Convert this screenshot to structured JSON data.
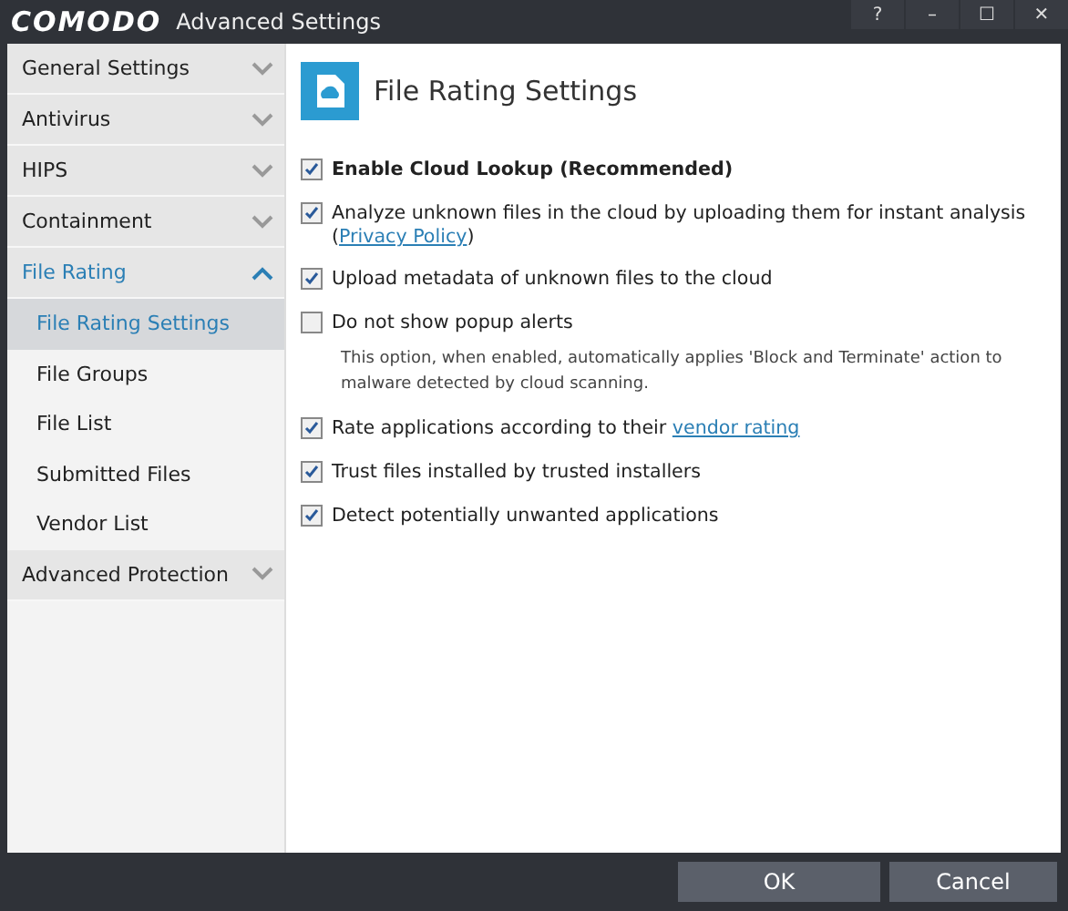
{
  "window": {
    "logo": "COMODO",
    "title": "Advanced Settings",
    "controls": [
      "?",
      "–",
      "☐",
      "✕"
    ]
  },
  "sidebar": {
    "items": [
      {
        "label": "General Settings",
        "expanded": false
      },
      {
        "label": "Antivirus",
        "expanded": false
      },
      {
        "label": "HIPS",
        "expanded": false
      },
      {
        "label": "Containment",
        "expanded": false
      },
      {
        "label": "File Rating",
        "expanded": true,
        "children": [
          {
            "label": "File Rating Settings",
            "selected": true
          },
          {
            "label": "File Groups",
            "selected": false
          },
          {
            "label": "File List",
            "selected": false
          },
          {
            "label": "Submitted Files",
            "selected": false
          },
          {
            "label": "Vendor List",
            "selected": false
          }
        ]
      },
      {
        "label": "Advanced Protection",
        "expanded": false
      }
    ]
  },
  "panel": {
    "title": "File Rating Settings",
    "options": [
      {
        "label": "Enable Cloud Lookup (Recommended)",
        "checked": true,
        "bold": true
      },
      {
        "label": "Analyze unknown files in the cloud by uploading them for instant analysis",
        "link_line": {
          "before": "(",
          "link": "Privacy Policy",
          "after": ")"
        },
        "checked": true
      },
      {
        "label": "Upload metadata of unknown files to the cloud",
        "checked": true
      },
      {
        "label": "Do not show popup alerts",
        "checked": false,
        "note": "This option, when enabled, automatically applies 'Block and Terminate' action to malware detected by cloud scanning."
      },
      {
        "label": "Rate applications according to their",
        "link": "vendor rating",
        "checked": true
      },
      {
        "label": "Trust files installed by trusted installers",
        "checked": true
      },
      {
        "label": "Detect potentially unwanted applications",
        "checked": true
      }
    ]
  },
  "buttons": [
    "OK",
    "Cancel"
  ]
}
